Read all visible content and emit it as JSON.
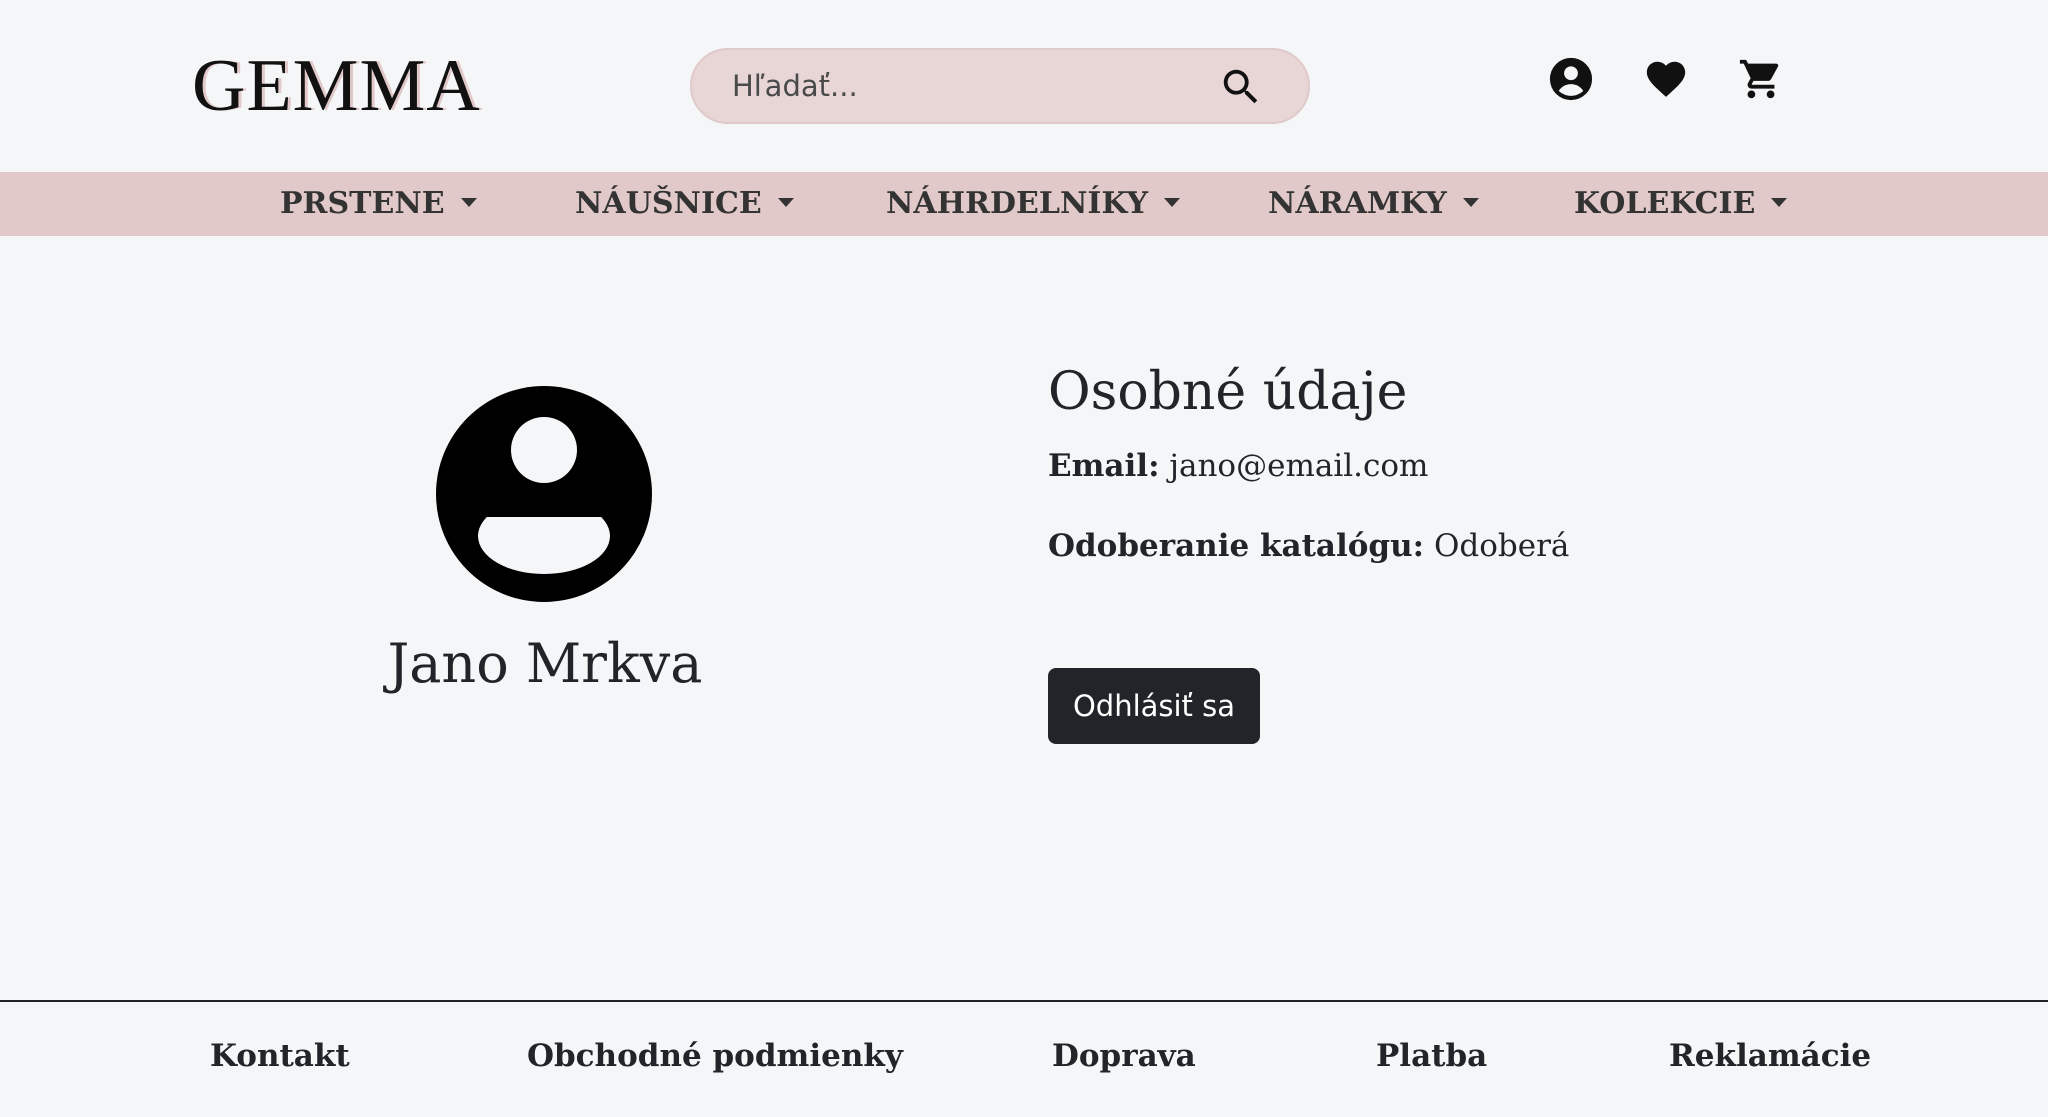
{
  "header": {
    "logo": "GEMMA",
    "search": {
      "placeholder": "Hľadať..."
    },
    "icons": [
      "account-icon",
      "heart-icon",
      "cart-icon"
    ]
  },
  "nav": {
    "items": [
      {
        "label": "PRSTENE"
      },
      {
        "label": "NÁUŠNICE"
      },
      {
        "label": "NÁHRDELNÍKY"
      },
      {
        "label": "NÁRAMKY"
      },
      {
        "label": "KOLEKCIE"
      }
    ]
  },
  "profile": {
    "name": "Jano Mrkva",
    "section_title": "Osobné údaje",
    "email_label": "Email:",
    "email_value": "jano@email.com",
    "catalog_label": "Odoberanie katalógu:",
    "catalog_value": "Odoberá",
    "logout_label": "Odhlásiť sa"
  },
  "footer": {
    "links": [
      {
        "label": "Kontakt"
      },
      {
        "label": "Obchodné podmienky"
      },
      {
        "label": "Doprava"
      },
      {
        "label": "Platba"
      },
      {
        "label": "Reklamácie"
      }
    ]
  },
  "colors": {
    "background": "#f5f6f8",
    "nav_background": "#e2c9c9",
    "search_background": "#e8d6d6",
    "button_dark": "#212529"
  }
}
